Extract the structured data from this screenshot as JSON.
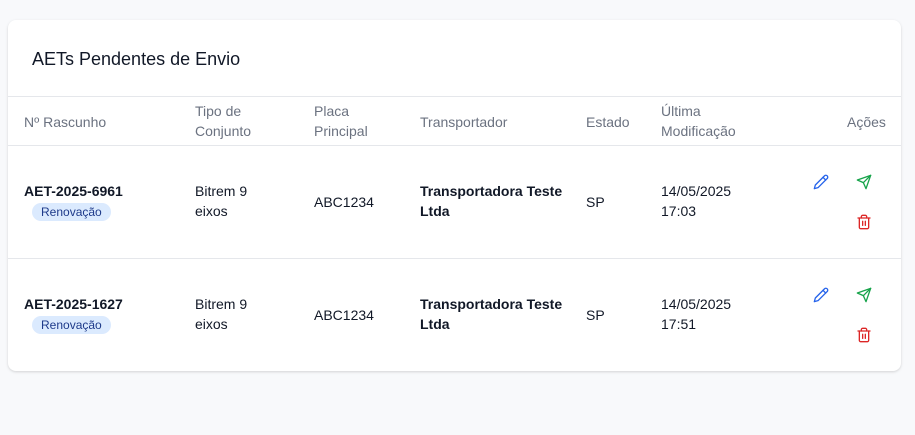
{
  "card": {
    "title": "AETs Pendentes de Envio"
  },
  "table": {
    "headers": {
      "rascunho": "Nº Rascunho",
      "tipo": "Tipo de Conjunto",
      "placa": "Placa Principal",
      "transportador": "Transportador",
      "estado": "Estado",
      "ultima": "Última Modificação",
      "acoes": "Ações"
    },
    "rows": [
      {
        "numero": "AET-2025-6961",
        "badge": "Renovação",
        "tipo": "Bitrem 9 eixos",
        "placa": "ABC1234",
        "transportador": "Transportadora Teste Ltda",
        "estado": "SP",
        "ultima": "14/05/2025 17:03"
      },
      {
        "numero": "AET-2025-1627",
        "badge": "Renovação",
        "tipo": "Bitrem 9 eixos",
        "placa": "ABC1234",
        "transportador": "Transportadora Teste Ltda",
        "estado": "SP",
        "ultima": "14/05/2025 17:51"
      }
    ]
  },
  "icons": {
    "edit": "pencil-icon",
    "send": "send-icon",
    "delete": "trash-icon"
  },
  "colors": {
    "edit": "#2563eb",
    "send": "#16a34a",
    "delete": "#dc2626",
    "badge_bg": "#dbeafe",
    "badge_text": "#1e3a8a"
  }
}
